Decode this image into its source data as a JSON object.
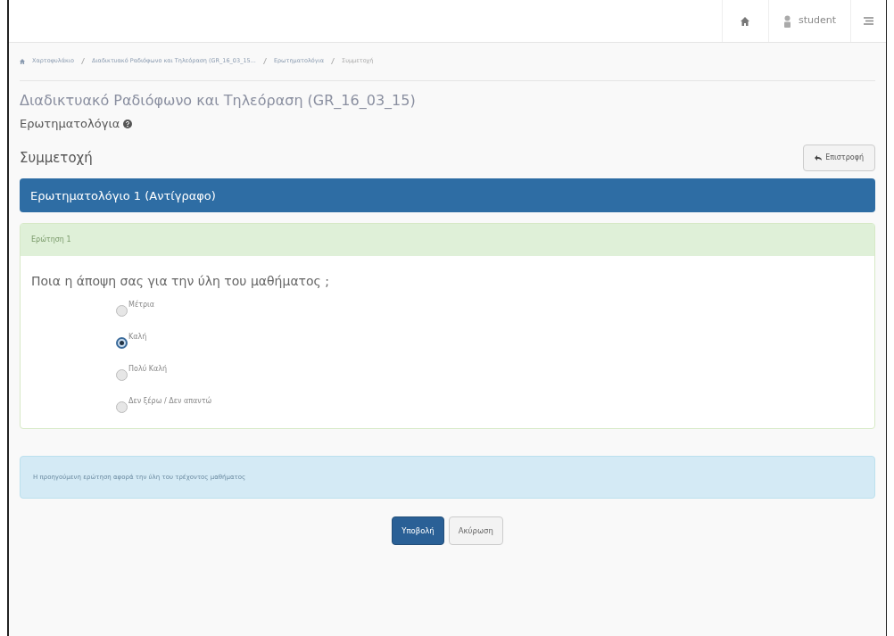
{
  "navbar": {
    "user": "student"
  },
  "breadcrumb": [
    "Χαρτοφυλάκιο",
    "Διαδικτυακό Ραδιόφωνο και Τηλεόραση (GR_16_03_15...",
    "Ερωτηματολόγια",
    "Συμμετοχή"
  ],
  "course_title": "Διαδικτυακό Ραδιόφωνο και Τηλεόραση (GR_16_03_15)",
  "module_title": "Ερωτηματολόγια",
  "section_title": "Συμμετοχή",
  "back_button": "Επιστροφή",
  "poll_title": "Ερωτηματολόγιο 1 (Αντίγραφο)",
  "question": {
    "heading": "Ερώτηση 1",
    "text": "Ποια η άποψη σας για την ύλη του μαθήματος ;",
    "options": [
      {
        "label": "Μέτρια",
        "selected": false
      },
      {
        "label": "Καλή",
        "selected": true
      },
      {
        "label": "Πολύ Καλή",
        "selected": false
      },
      {
        "label": "Δεν ξέρω / Δεν απαντώ",
        "selected": false
      }
    ]
  },
  "info": "Η προηγούμενη ερώτηση αφορά την ύλη του τρέχοντος μαθήματος",
  "buttons": {
    "submit": "Υποβολή",
    "cancel": "Ακύρωση"
  }
}
